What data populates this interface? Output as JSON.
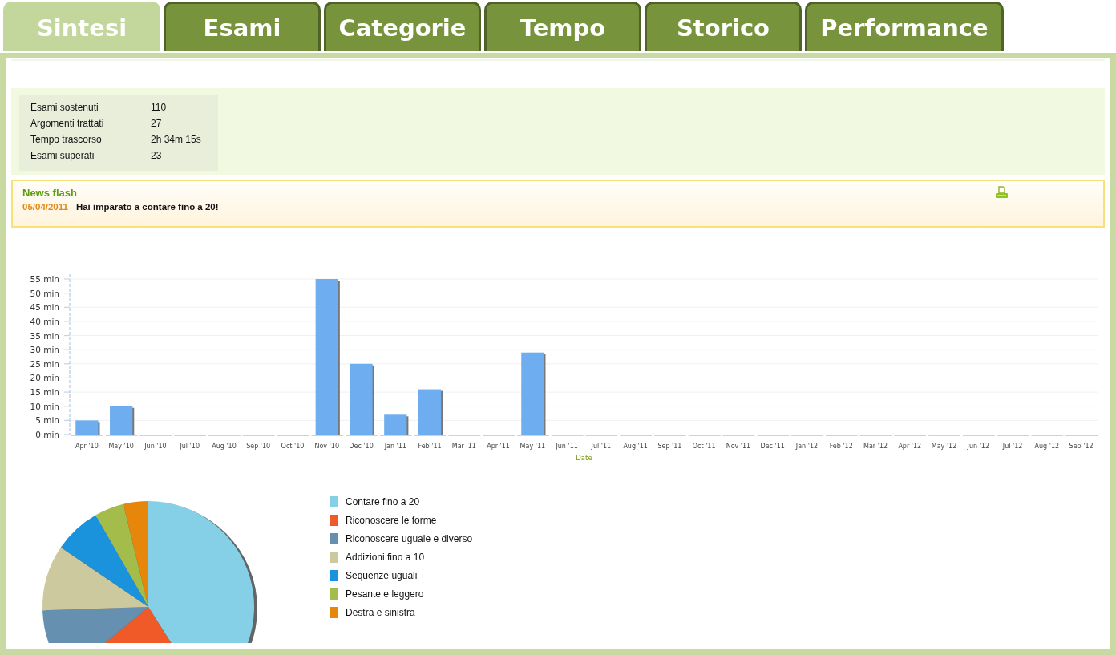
{
  "tabs": [
    {
      "label": "Sintesi",
      "selected": true
    },
    {
      "label": "Esami",
      "selected": false
    },
    {
      "label": "Categorie",
      "selected": false
    },
    {
      "label": "Tempo",
      "selected": false
    },
    {
      "label": "Storico",
      "selected": false
    },
    {
      "label": "Performance",
      "selected": false
    }
  ],
  "summary": [
    {
      "label": "Esami sostenuti",
      "value": "110"
    },
    {
      "label": "Argomenti trattati",
      "value": "27"
    },
    {
      "label": "Tempo trascorso",
      "value": "2h 34m 15s"
    },
    {
      "label": "Esami superati",
      "value": "23"
    }
  ],
  "news": {
    "title": "News flash",
    "items": [
      {
        "date": "05/04/2011",
        "text": "Hai imparato a contare fino a 20!"
      }
    ]
  },
  "time_chart": {
    "chart_data": {
      "type": "bar",
      "xlabel": "Date",
      "categories": [
        "Apr '10",
        "May '10",
        "Jun '10",
        "Jul '10",
        "Aug '10",
        "Sep '10",
        "Oct '10",
        "Nov '10",
        "Dec '10",
        "Jan '11",
        "Feb '11",
        "Mar '11",
        "Apr '11",
        "May '11",
        "Jun '11",
        "Jul '11",
        "Aug '11",
        "Sep '11",
        "Oct '11",
        "Nov '11",
        "Dec '11",
        "Jan '12",
        "Feb '12",
        "Mar '12",
        "Apr '12",
        "May '12",
        "Jun '12",
        "Jul '12",
        "Aug '12",
        "Sep '12"
      ],
      "grid": true,
      "series": [
        {
          "color": "#6eaef0",
          "values": [
            5,
            10,
            0,
            0,
            0,
            0,
            0,
            55,
            25,
            7,
            16,
            0,
            0,
            29,
            0,
            0,
            0,
            0,
            0,
            0,
            0,
            0,
            0,
            0,
            0,
            0,
            0,
            0,
            0,
            0
          ]
        }
      ],
      "ylim": [
        0,
        55
      ],
      "yticks": [
        {
          "value": 0,
          "label": "0 min"
        },
        {
          "value": 5,
          "label": "5 min"
        },
        {
          "value": 10,
          "label": "10 min"
        },
        {
          "value": 15,
          "label": "15 min"
        },
        {
          "value": 20,
          "label": "20 min"
        },
        {
          "value": 25,
          "label": "25 min"
        },
        {
          "value": 30,
          "label": "30 min"
        },
        {
          "value": 35,
          "label": "35 min"
        },
        {
          "value": 40,
          "label": "40 min"
        },
        {
          "value": 45,
          "label": "45 min"
        },
        {
          "value": 50,
          "label": "50 min"
        },
        {
          "value": 55,
          "label": "55 min"
        }
      ]
    }
  },
  "topics": {
    "legend": [
      {
        "label": "Contare fino a 20",
        "color": "#85d0e6"
      },
      {
        "label": "Riconoscere le forme",
        "color": "#f05a28"
      },
      {
        "label": "Riconoscere uguale e diverso",
        "color": "#6590b0"
      },
      {
        "label": "Addizioni fino a 10",
        "color": "#cbc99d"
      },
      {
        "label": "Sequenze uguali",
        "color": "#1a93dc"
      },
      {
        "label": "Pesante e leggero",
        "color": "#a4bc4a"
      },
      {
        "label": "Destra e sinistra",
        "color": "#e6860a"
      }
    ]
  }
}
